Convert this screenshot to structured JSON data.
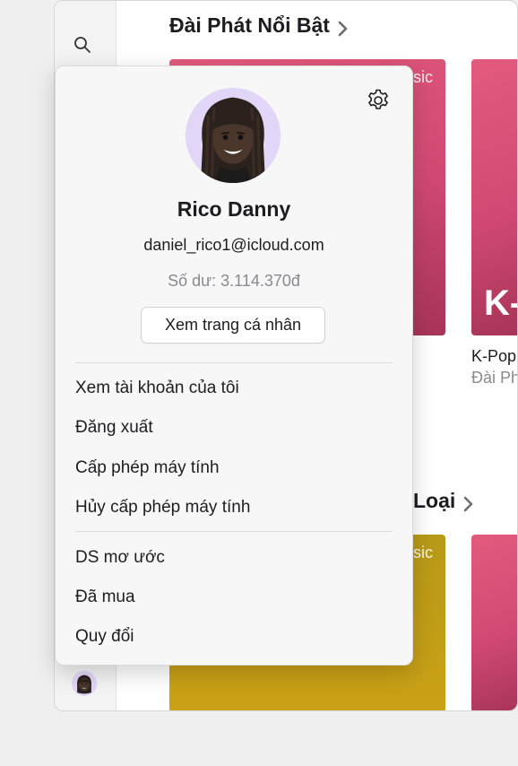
{
  "sections": {
    "featured_title": "Đài Phát Nổi Bật",
    "category_title": "Loại"
  },
  "cards": {
    "tag1": "sic",
    "tag2": "sic",
    "big_text": "K-",
    "caption_title": "K-Pop",
    "caption_sub": "Đài Ph"
  },
  "profile": {
    "name": "Rico Danny",
    "email": "daniel_rico1@icloud.com",
    "balance": "Số dư: 3.114.370đ",
    "view_profile_label": "Xem trang cá nhân"
  },
  "menu": {
    "group1": [
      "Xem tài khoản của tôi",
      "Đăng xuất",
      "Cấp phép máy tính",
      "Hủy cấp phép máy tính"
    ],
    "group2": [
      "DS mơ ước",
      "Đã mua",
      "Quy đổi"
    ]
  },
  "icons": {
    "search": "search-icon",
    "settings": "gear-icon",
    "chevron": "chevron-right-icon",
    "avatar": "memoji-avatar"
  },
  "colors": {
    "card_pink": "#d24a73",
    "card_gold": "#caa116",
    "secondary_text": "#8a8a8e"
  }
}
